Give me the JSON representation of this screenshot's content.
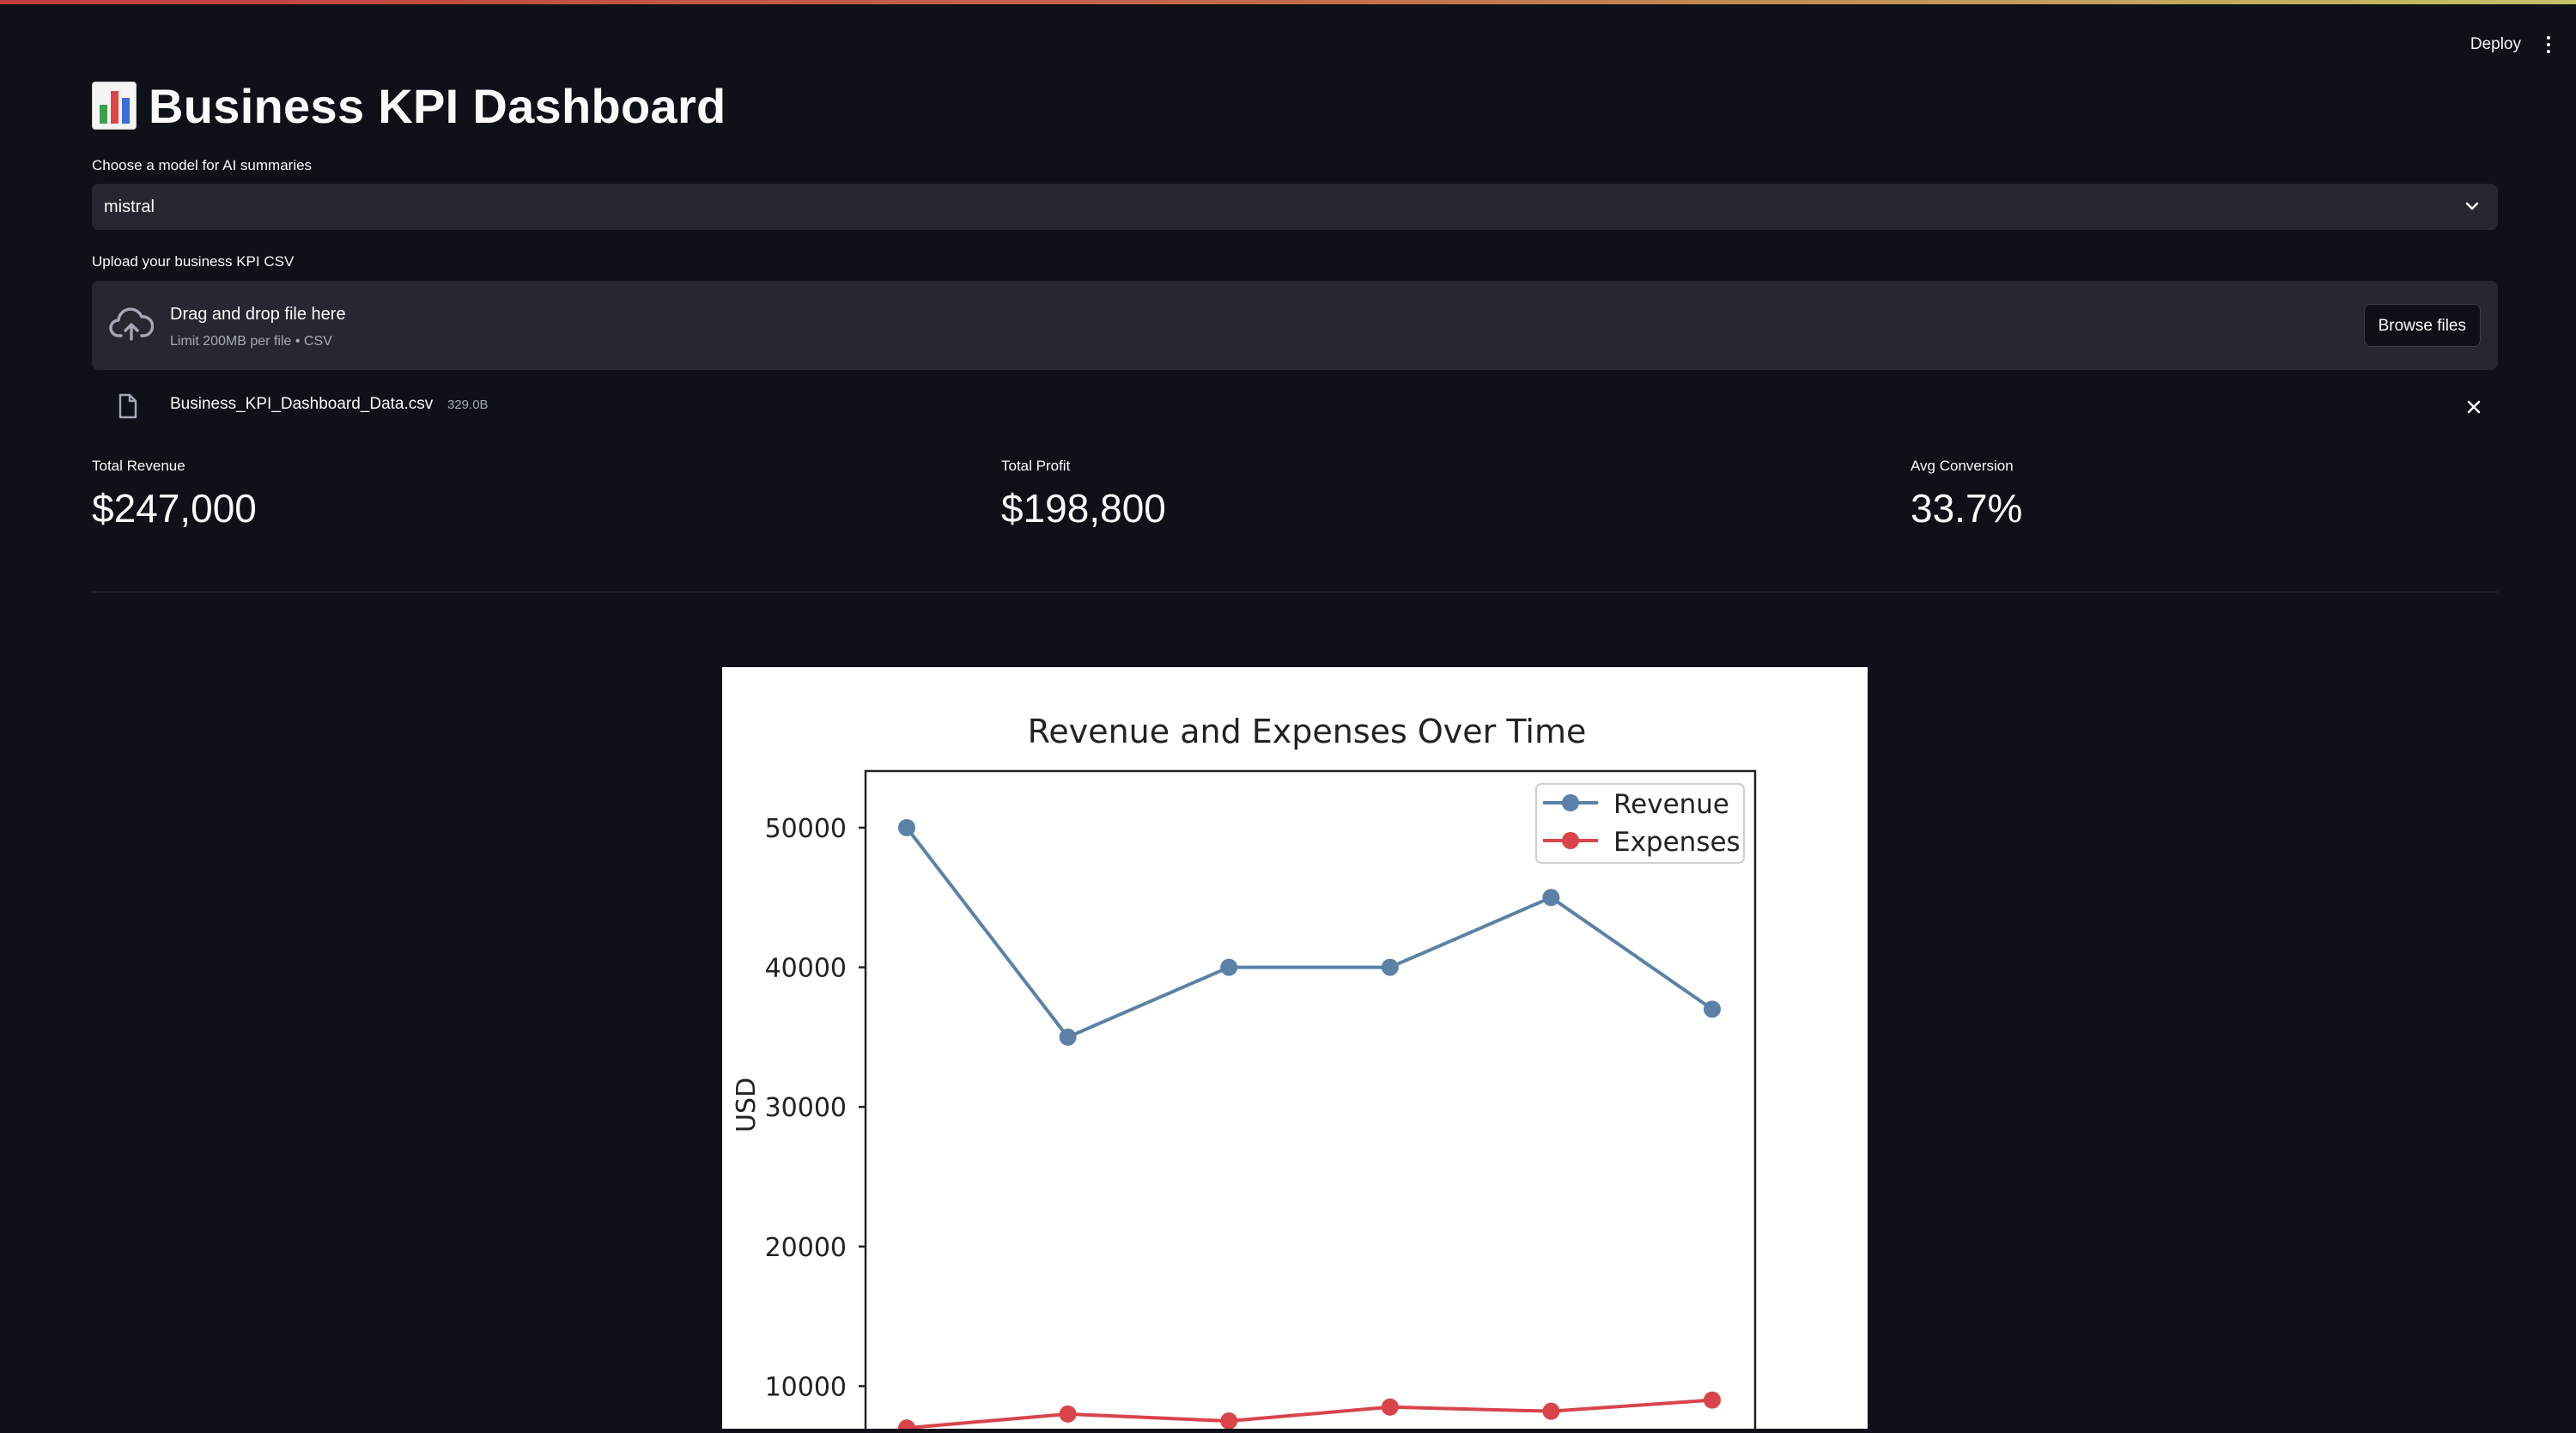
{
  "app": {
    "deploy_label": "Deploy",
    "title": "Business KPI Dashboard",
    "title_icon": "bar-chart-emoji-icon"
  },
  "model_select": {
    "label": "Choose a model for AI summaries",
    "value": "mistral"
  },
  "uploader": {
    "label": "Upload your business KPI CSV",
    "drop_title": "Drag and drop file here",
    "drop_limit": "Limit 200MB per file • CSV",
    "browse_label": "Browse files",
    "file_name": "Business_KPI_Dashboard_Data.csv",
    "file_size": "329.0B"
  },
  "metrics": [
    {
      "label": "Total Revenue",
      "value": "$247,000"
    },
    {
      "label": "Total Profit",
      "value": "$198,800"
    },
    {
      "label": "Avg Conversion",
      "value": "33.7%"
    }
  ],
  "colors": {
    "background": "#0e1117",
    "widget": "#262730",
    "revenue": "#5b82a6",
    "expenses": "#d9444b"
  },
  "chart_data": {
    "type": "line",
    "title": "Revenue and Expenses Over Time",
    "xlabel": "",
    "ylabel": "USD",
    "ylim": [
      0,
      52000
    ],
    "yticks": [
      10000,
      20000,
      30000,
      40000,
      50000
    ],
    "x": [
      1,
      2,
      3,
      4,
      5,
      6
    ],
    "legend": "top-right",
    "grid": false,
    "series": [
      {
        "name": "Revenue",
        "color": "#5b82a6",
        "values": [
          50000,
          35000,
          40000,
          40000,
          45000,
          37000
        ]
      },
      {
        "name": "Expenses",
        "color": "#d9444b",
        "values": [
          7000,
          8000,
          7500,
          8500,
          8200,
          9000
        ]
      }
    ]
  }
}
